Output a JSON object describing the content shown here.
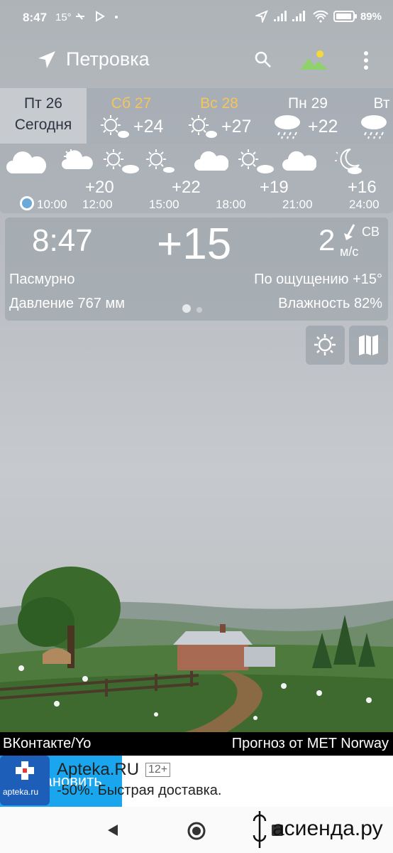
{
  "status_bar": {
    "time": "8:47",
    "temp": "15°",
    "battery": "89%"
  },
  "toolbar": {
    "city": "Петровка"
  },
  "days": [
    {
      "name": "Пт 26",
      "sub": "Сегодня",
      "temp": "",
      "weekend": false,
      "today": true
    },
    {
      "name": "Сб 27",
      "sub": "",
      "temp": "+24",
      "weekend": true,
      "today": false
    },
    {
      "name": "Вс 28",
      "sub": "",
      "temp": "+27",
      "weekend": true,
      "today": false
    },
    {
      "name": "Пн 29",
      "sub": "",
      "temp": "+22",
      "weekend": false,
      "today": false
    },
    {
      "name": "Вт",
      "sub": "",
      "temp": "",
      "weekend": false,
      "today": false
    }
  ],
  "hourly": {
    "temps": [
      "+20",
      "+22",
      "+19",
      "+16"
    ],
    "hours": [
      "10:00",
      "12:00",
      "15:00",
      "18:00",
      "21:00",
      "24:00"
    ]
  },
  "current": {
    "time": "8:47",
    "temp": "+15",
    "wind_speed": "2",
    "wind_dir": "СВ",
    "wind_unit": "м/с",
    "condition": "Пасмурно",
    "feels_like": "По ощущению +15°",
    "pressure": "Давление 767 мм",
    "humidity": "Влажность 82%"
  },
  "credits": {
    "left": "ВКонтакте/Yo",
    "right": "Прогноз от MET Norway"
  },
  "ad": {
    "logo_text": "apteka.ru",
    "title": "Apteka.RU",
    "age": "12+",
    "subtitle": "-50%. Быстрая доставка.",
    "button": "Установить"
  },
  "watermark": "асиенда.ру",
  "colors": {
    "weekend": "#f3c55a",
    "install": "#1aa6ee",
    "sun": "#ffffff"
  }
}
